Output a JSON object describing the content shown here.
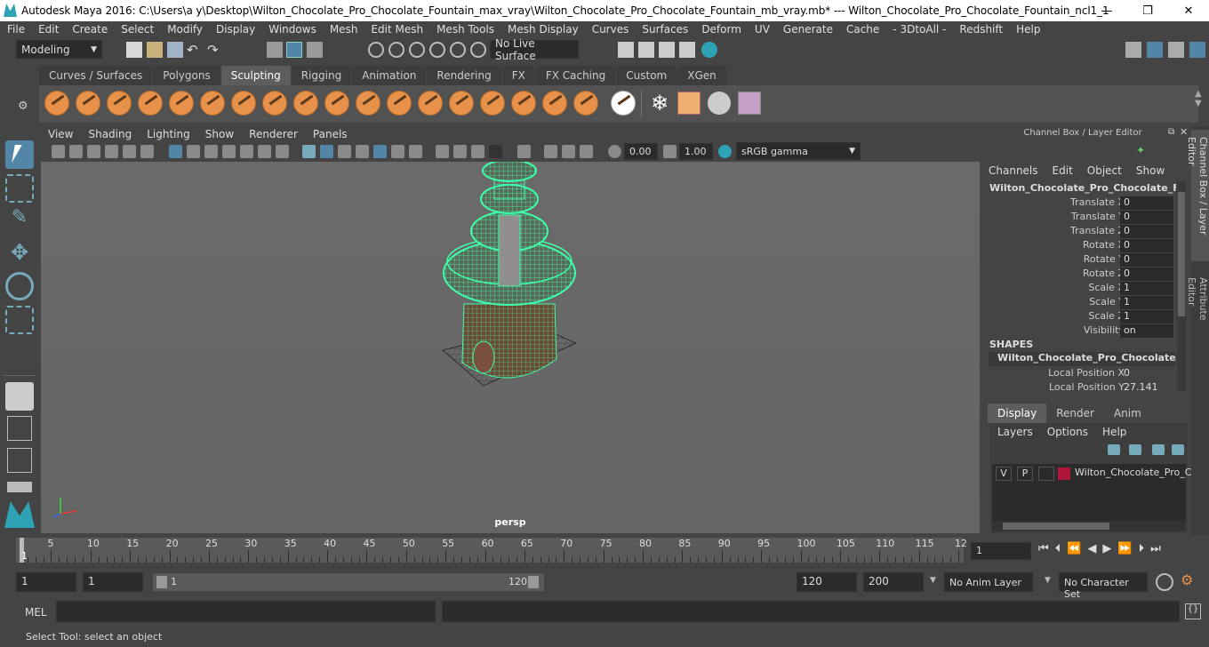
{
  "window": {
    "title": "Autodesk Maya 2016: C:\\Users\\a y\\Desktop\\Wilton_Chocolate_Pro_Chocolate_Fountain_max_vray\\Wilton_Chocolate_Pro_Chocolate_Fountain_mb_vray.mb*   ---   Wilton_Chocolate_Pro_Chocolate_Fountain_ncl1_1",
    "minimize": "—",
    "maximize": "❐",
    "close": "✕"
  },
  "menu": [
    "File",
    "Edit",
    "Create",
    "Select",
    "Modify",
    "Display",
    "Windows",
    "Mesh",
    "Edit Mesh",
    "Mesh Tools",
    "Mesh Display",
    "Curves",
    "Surfaces",
    "Deform",
    "UV",
    "Generate",
    "Cache",
    "- 3DtoAll -",
    "Redshift",
    "Help"
  ],
  "statusline": {
    "mode": "Modeling",
    "live_surface": "No Live Surface"
  },
  "shelf_tabs": [
    {
      "label": "Curves / Surfaces",
      "active": false
    },
    {
      "label": "Polygons",
      "active": false
    },
    {
      "label": "Sculpting",
      "active": true
    },
    {
      "label": "Rigging",
      "active": false
    },
    {
      "label": "Animation",
      "active": false
    },
    {
      "label": "Rendering",
      "active": false
    },
    {
      "label": "FX",
      "active": false
    },
    {
      "label": "FX Caching",
      "active": false
    },
    {
      "label": "Custom",
      "active": false
    },
    {
      "label": "XGen",
      "active": false
    }
  ],
  "viewport": {
    "menu": [
      "View",
      "Shading",
      "Lighting",
      "Show",
      "Renderer",
      "Panels"
    ],
    "exposure": "0.00",
    "gamma": "1.00",
    "color_space": "sRGB gamma",
    "camera": "persp"
  },
  "channel_box": {
    "header": "Channel Box / Layer Editor",
    "menu": [
      "Channels",
      "Edit",
      "Object",
      "Show"
    ],
    "object_name": "Wilton_Chocolate_Pro_Chocolate_Fou...",
    "channels": [
      {
        "label": "Translate X",
        "value": "0"
      },
      {
        "label": "Translate Y",
        "value": "0"
      },
      {
        "label": "Translate Z",
        "value": "0"
      },
      {
        "label": "Rotate X",
        "value": "0"
      },
      {
        "label": "Rotate Y",
        "value": "0"
      },
      {
        "label": "Rotate Z",
        "value": "0"
      },
      {
        "label": "Scale X",
        "value": "1"
      },
      {
        "label": "Scale Y",
        "value": "1"
      },
      {
        "label": "Scale Z",
        "value": "1"
      },
      {
        "label": "Visibility",
        "value": "on"
      }
    ],
    "shapes_label": "SHAPES",
    "shape_name": "Wilton_Chocolate_Pro_Chocolate_F...",
    "shape_channels": [
      {
        "label": "Local Position X",
        "value": "0"
      },
      {
        "label": "Local Position Y",
        "value": "27.141"
      }
    ]
  },
  "side_tabs": {
    "channel_box": "Channel Box / Layer Editor",
    "attribute_editor": "Attribute Editor"
  },
  "layer_editor": {
    "tabs": [
      {
        "label": "Display",
        "active": true
      },
      {
        "label": "Render",
        "active": false
      },
      {
        "label": "Anim",
        "active": false
      }
    ],
    "menu": [
      "Layers",
      "Options",
      "Help"
    ],
    "layer": {
      "v": "V",
      "p": "P",
      "name": "Wilton_Chocolate_Pro_C",
      "color": "#b0163a"
    }
  },
  "timeline": {
    "ticks": [
      "5",
      "10",
      "15",
      "20",
      "25",
      "30",
      "35",
      "40",
      "45",
      "50",
      "55",
      "60",
      "65",
      "70",
      "75",
      "80",
      "85",
      "90",
      "95",
      "100",
      "105",
      "110",
      "115",
      "12"
    ],
    "current_frame_marker": "1",
    "current_frame": "1"
  },
  "range": {
    "start": "1",
    "playback_start": "1",
    "slider_start": "1",
    "slider_end": "120",
    "playback_end": "120",
    "end": "200",
    "anim_layer": "No Anim Layer",
    "character_set": "No Character Set"
  },
  "command": {
    "label": "MEL"
  },
  "help_line": "Select Tool: select an object",
  "colors": {
    "wireframe": "#3dffa8",
    "layer_color": "#b0163a",
    "accent": "#5285a6"
  }
}
